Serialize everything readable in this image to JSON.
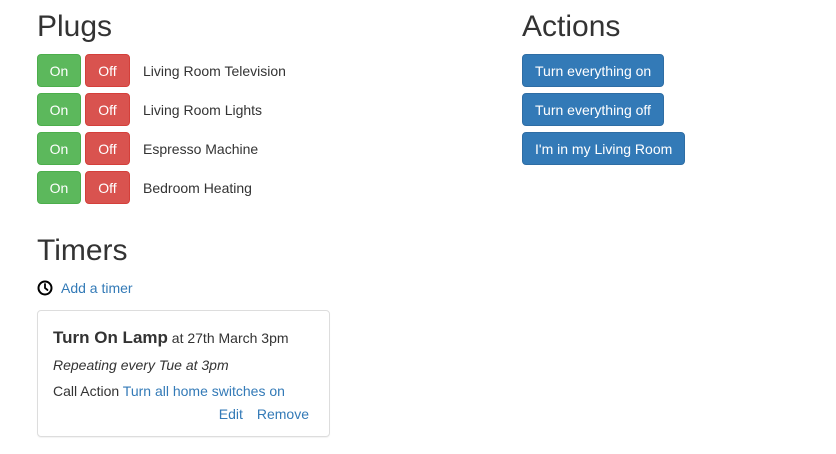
{
  "plugs": {
    "heading": "Plugs",
    "on_label": "On",
    "off_label": "Off",
    "items": [
      {
        "name": "Living Room Television"
      },
      {
        "name": "Living Room Lights"
      },
      {
        "name": "Espresso Machine"
      },
      {
        "name": "Bedroom Heating"
      }
    ]
  },
  "actions": {
    "heading": "Actions",
    "buttons": [
      {
        "label": "Turn everything on"
      },
      {
        "label": "Turn everything off"
      },
      {
        "label": "I'm in my Living Room"
      }
    ]
  },
  "timers": {
    "heading": "Timers",
    "add_label": "Add a timer",
    "add_icon": "clock-icon",
    "items": [
      {
        "title": "Turn On Lamp",
        "when": "at 27th March 3pm",
        "repeat": "Repeating every Tue at 3pm",
        "action_prefix": "Call Action",
        "action_link": "Turn all home switches on",
        "edit_label": "Edit",
        "remove_label": "Remove"
      }
    ]
  },
  "colors": {
    "on": "#5cb85c",
    "off": "#d9534f",
    "primary": "#337ab7"
  }
}
